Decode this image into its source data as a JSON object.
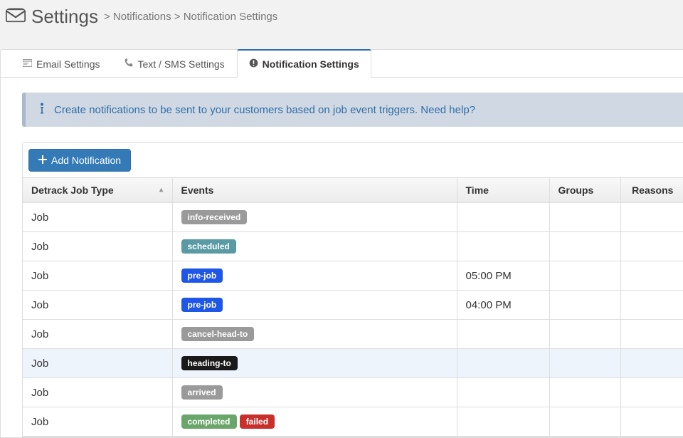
{
  "header": {
    "title": "Settings",
    "breadcrumb_notifications": "Notifications",
    "breadcrumb_notification_settings": "Notification Settings"
  },
  "tabs": {
    "email": "Email Settings",
    "sms": "Text / SMS Settings",
    "notif": "Notification Settings"
  },
  "info": {
    "text": "Create notifications to be sent to your customers based on job event triggers. ",
    "help": "Need help?"
  },
  "toolbar": {
    "add_label": "Add Notification"
  },
  "columns": {
    "jobtype": "Detrack Job Type",
    "events": "Events",
    "time": "Time",
    "groups": "Groups",
    "reasons": "Reasons"
  },
  "rows": [
    {
      "jobtype": "Job",
      "events": [
        {
          "label": "info-received",
          "cls": "b-gray"
        }
      ],
      "time": "",
      "highlight": false
    },
    {
      "jobtype": "Job",
      "events": [
        {
          "label": "scheduled",
          "cls": "b-teal"
        }
      ],
      "time": "",
      "highlight": false
    },
    {
      "jobtype": "Job",
      "events": [
        {
          "label": "pre-job",
          "cls": "b-blue"
        }
      ],
      "time": "05:00 PM",
      "highlight": false
    },
    {
      "jobtype": "Job",
      "events": [
        {
          "label": "pre-job",
          "cls": "b-blue"
        }
      ],
      "time": "04:00 PM",
      "highlight": false
    },
    {
      "jobtype": "Job",
      "events": [
        {
          "label": "cancel-head-to",
          "cls": "b-gray"
        }
      ],
      "time": "",
      "highlight": false
    },
    {
      "jobtype": "Job",
      "events": [
        {
          "label": "heading-to",
          "cls": "b-black"
        }
      ],
      "time": "",
      "highlight": true
    },
    {
      "jobtype": "Job",
      "events": [
        {
          "label": "arrived",
          "cls": "b-gray"
        }
      ],
      "time": "",
      "highlight": false
    },
    {
      "jobtype": "Job",
      "events": [
        {
          "label": "completed",
          "cls": "b-green"
        },
        {
          "label": "failed",
          "cls": "b-red"
        }
      ],
      "time": "",
      "highlight": false
    }
  ]
}
